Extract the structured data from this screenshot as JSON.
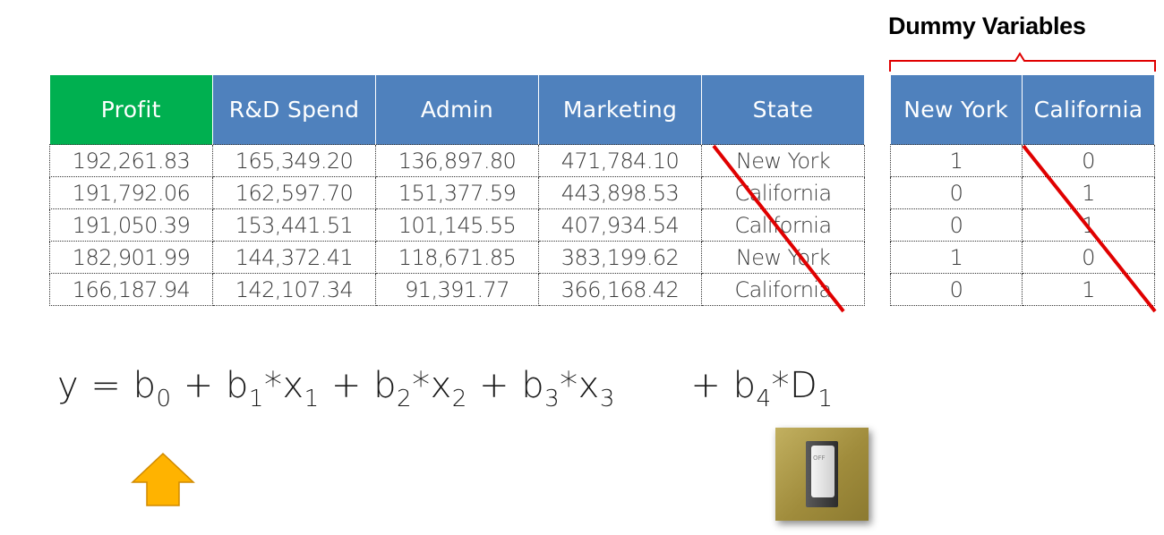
{
  "slide": {
    "title": "Dummy Variables"
  },
  "main_table": {
    "headers": [
      "Profit",
      "R&D Spend",
      "Admin",
      "Marketing",
      "State"
    ],
    "rows": [
      [
        "192,261.83",
        "165,349.20",
        "136,897.80",
        "471,784.10",
        "New York"
      ],
      [
        "191,792.06",
        "162,597.70",
        "151,377.59",
        "443,898.53",
        "California"
      ],
      [
        "191,050.39",
        "153,441.51",
        "101,145.55",
        "407,934.54",
        "California"
      ],
      [
        "182,901.99",
        "144,372.41",
        "118,671.85",
        "383,199.62",
        "New York"
      ],
      [
        "166,187.94",
        "142,107.34",
        "91,391.77",
        "366,168.42",
        "California"
      ]
    ]
  },
  "dummy_table": {
    "headers": [
      "New York",
      "California"
    ],
    "rows": [
      [
        "1",
        "0"
      ],
      [
        "0",
        "1"
      ],
      [
        "0",
        "1"
      ],
      [
        "1",
        "0"
      ],
      [
        "0",
        "1"
      ]
    ]
  },
  "equation": {
    "y": "y",
    "eq": "=",
    "plus": "+",
    "star": "*",
    "b0": "b",
    "b0_sub": "0",
    "b1": "b",
    "b1_sub": "1",
    "x1": "x",
    "x1_sub": "1",
    "b2": "b",
    "b2_sub": "2",
    "x2": "x",
    "x2_sub": "2",
    "b3": "b",
    "b3_sub": "3",
    "x3": "x",
    "x3_sub": "3",
    "b4": "b",
    "b4_sub": "4",
    "d1": "D",
    "d1_sub": "1"
  },
  "switch": {
    "label": "OFF"
  },
  "colors": {
    "header_blue": "#4f81bd",
    "profit_green": "#00b050",
    "strike_red": "#e00000",
    "arrow_yellow": "#ffb300"
  }
}
